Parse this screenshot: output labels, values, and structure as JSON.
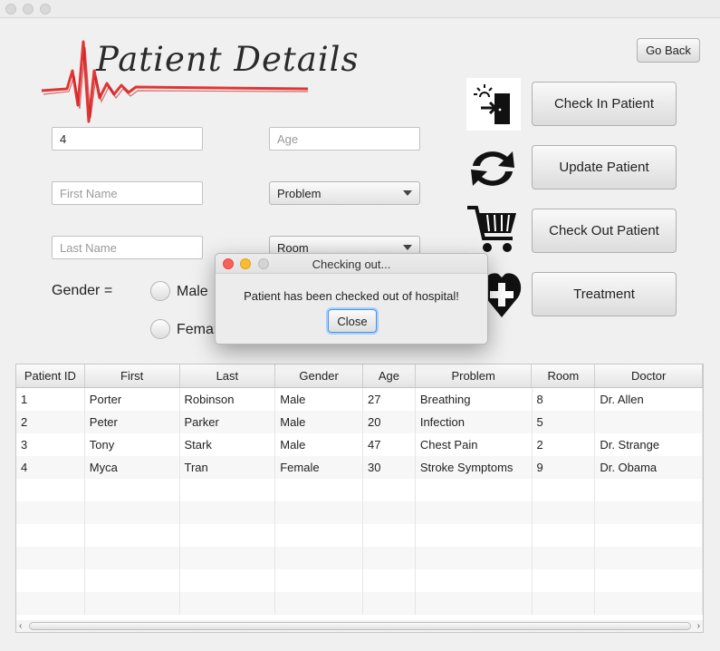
{
  "header": {
    "title": "Patient Details"
  },
  "nav": {
    "go_back": "Go Back"
  },
  "actions": {
    "check_in": "Check In Patient",
    "update": "Update Patient",
    "check_out": "Check Out Patient",
    "treatment": "Treatment"
  },
  "form": {
    "patient_id": {
      "value": "4"
    },
    "age": {
      "placeholder": "Age"
    },
    "first_name": {
      "placeholder": "First Name"
    },
    "last_name": {
      "placeholder": "Last Name"
    },
    "problem": {
      "selected": "Problem"
    },
    "room": {
      "selected": "Room"
    },
    "gender_label": "Gender =",
    "gender_options": [
      "Male",
      "Female"
    ]
  },
  "table": {
    "columns": [
      "Patient ID",
      "First",
      "Last",
      "Gender",
      "Age",
      "Problem",
      "Room",
      "Doctor"
    ],
    "rows": [
      [
        "1",
        "Porter",
        "Robinson",
        "Male",
        "27",
        "Breathing",
        "8",
        "Dr. Allen"
      ],
      [
        "2",
        "Peter",
        "Parker",
        "Male",
        "20",
        "Infection",
        "5",
        ""
      ],
      [
        "3",
        "Tony",
        "Stark",
        "Male",
        "47",
        "Chest Pain",
        "2",
        "Dr. Strange"
      ],
      [
        "4",
        "Myca",
        "Tran",
        "Female",
        "30",
        "Stroke Symptoms",
        "9",
        "Dr. Obama"
      ]
    ]
  },
  "dialog": {
    "title": "Checking out...",
    "message": "Patient has been checked out of hospital!",
    "close_label": "Close"
  },
  "colors": {
    "logo_red": "#e02020",
    "focus_blue": "#3b99fc",
    "close_dot": "#fc5f57",
    "minimize_dot": "#fdbc2e"
  },
  "icons": {
    "check_in": "door-enter-icon",
    "update": "refresh-arrows-icon",
    "check_out": "shopping-cart-icon",
    "treatment": "heart-plus-icon"
  }
}
